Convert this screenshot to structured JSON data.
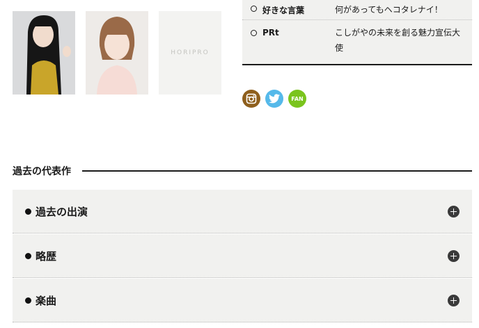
{
  "profile": {
    "rows": [
      {
        "key": "好きな言葉",
        "value": "何があってもヘコタレナイ！"
      },
      {
        "key": "PRt",
        "value": "こしがやの未来を創る魅力宣伝大使"
      }
    ]
  },
  "photos": {
    "logo_text": "HORIPRO"
  },
  "social": {
    "fan_label": "FAN"
  },
  "section": {
    "title": "過去の代表作"
  },
  "accordion": [
    {
      "title": "過去の出演"
    },
    {
      "title": "略歴"
    },
    {
      "title": "楽曲"
    }
  ],
  "colors": {
    "panel_bg": "#f1f1ef",
    "instagram": "#8e5f1d",
    "twitter": "#55b9ea",
    "fan": "#7ac41d"
  }
}
